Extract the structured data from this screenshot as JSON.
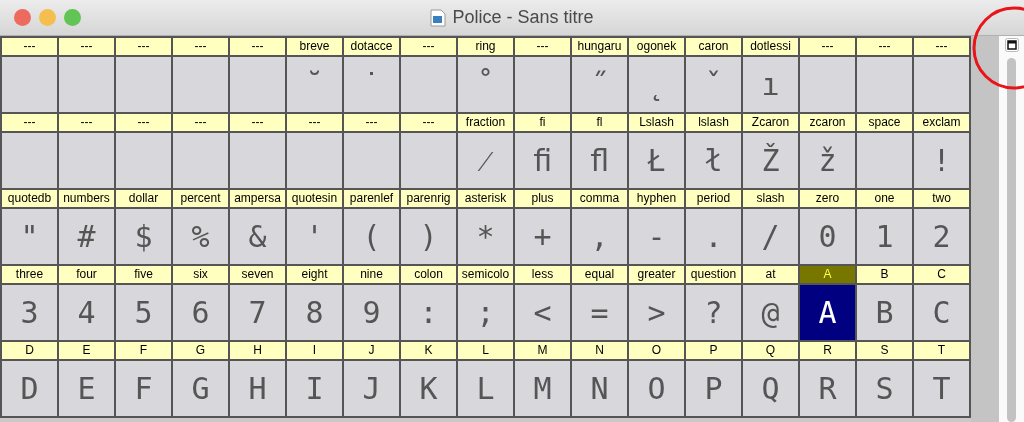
{
  "window": {
    "title": "Police - Sans titre"
  },
  "rows": [
    {
      "cells": [
        {
          "name": "---",
          "selected": false
        },
        {
          "name": "---",
          "selected": false
        },
        {
          "name": "---",
          "selected": false
        },
        {
          "name": "---",
          "selected": false
        },
        {
          "name": "---",
          "selected": false
        },
        {
          "name": "breve",
          "glyph": "˘",
          "selected": false
        },
        {
          "name": "dotacce",
          "glyph": "˙",
          "selected": false
        },
        {
          "name": "---",
          "selected": false
        },
        {
          "name": "ring",
          "glyph": "˚",
          "selected": false
        },
        {
          "name": "---",
          "selected": false
        },
        {
          "name": "hungaru",
          "glyph": "˝",
          "selected": false
        },
        {
          "name": "ogonek",
          "glyph": "˛",
          "selected": false
        },
        {
          "name": "caron",
          "glyph": "ˇ",
          "selected": false
        },
        {
          "name": "dotlessi",
          "glyph": "ı",
          "selected": false
        },
        {
          "name": "---",
          "selected": false
        },
        {
          "name": "---",
          "selected": false
        },
        {
          "name": "---",
          "selected": false
        }
      ]
    },
    {
      "cells": [
        {
          "name": "---",
          "selected": false
        },
        {
          "name": "---",
          "selected": false
        },
        {
          "name": "---",
          "selected": false
        },
        {
          "name": "---",
          "selected": false
        },
        {
          "name": "---",
          "selected": false
        },
        {
          "name": "---",
          "selected": false
        },
        {
          "name": "---",
          "selected": false
        },
        {
          "name": "---",
          "selected": false
        },
        {
          "name": "fraction",
          "glyph": "⁄",
          "selected": false
        },
        {
          "name": "fi",
          "glyph": "ﬁ",
          "selected": false
        },
        {
          "name": "fl",
          "glyph": "ﬂ",
          "selected": false
        },
        {
          "name": "Lslash",
          "glyph": "Ł",
          "selected": false
        },
        {
          "name": "lslash",
          "glyph": "ł",
          "selected": false
        },
        {
          "name": "Zcaron",
          "glyph": "Ž",
          "selected": false
        },
        {
          "name": "zcaron",
          "glyph": "ž",
          "selected": false
        },
        {
          "name": "space",
          "selected": false
        },
        {
          "name": "exclam",
          "glyph": "!",
          "selected": false
        }
      ]
    },
    {
      "cells": [
        {
          "name": "quotedb",
          "glyph": "\"",
          "selected": false
        },
        {
          "name": "numbers",
          "glyph": "#",
          "selected": false
        },
        {
          "name": "dollar",
          "glyph": "$",
          "selected": false
        },
        {
          "name": "percent",
          "glyph": "%",
          "selected": false
        },
        {
          "name": "ampersa",
          "glyph": "&",
          "selected": false
        },
        {
          "name": "quotesin",
          "glyph": "'",
          "selected": false
        },
        {
          "name": "parenlef",
          "glyph": "(",
          "selected": false
        },
        {
          "name": "parenrig",
          "glyph": ")",
          "selected": false
        },
        {
          "name": "asterisk",
          "glyph": "*",
          "selected": false
        },
        {
          "name": "plus",
          "glyph": "+",
          "selected": false
        },
        {
          "name": "comma",
          "glyph": ",",
          "selected": false
        },
        {
          "name": "hyphen",
          "glyph": "-",
          "selected": false
        },
        {
          "name": "period",
          "glyph": ".",
          "selected": false
        },
        {
          "name": "slash",
          "glyph": "/",
          "selected": false
        },
        {
          "name": "zero",
          "glyph": "0",
          "selected": false
        },
        {
          "name": "one",
          "glyph": "1",
          "selected": false
        },
        {
          "name": "two",
          "glyph": "2",
          "selected": false
        }
      ]
    },
    {
      "cells": [
        {
          "name": "three",
          "glyph": "3",
          "selected": false
        },
        {
          "name": "four",
          "glyph": "4",
          "selected": false
        },
        {
          "name": "five",
          "glyph": "5",
          "selected": false
        },
        {
          "name": "six",
          "glyph": "6",
          "selected": false
        },
        {
          "name": "seven",
          "glyph": "7",
          "selected": false
        },
        {
          "name": "eight",
          "glyph": "8",
          "selected": false
        },
        {
          "name": "nine",
          "glyph": "9",
          "selected": false
        },
        {
          "name": "colon",
          "glyph": ":",
          "selected": false
        },
        {
          "name": "semicolo",
          "glyph": ";",
          "selected": false
        },
        {
          "name": "less",
          "glyph": "<",
          "selected": false
        },
        {
          "name": "equal",
          "glyph": "=",
          "selected": false
        },
        {
          "name": "greater",
          "glyph": ">",
          "selected": false
        },
        {
          "name": "question",
          "glyph": "?",
          "selected": false
        },
        {
          "name": "at",
          "glyph": "@",
          "selected": false
        },
        {
          "name": "A",
          "glyph": "A",
          "selected": true
        },
        {
          "name": "B",
          "glyph": "B",
          "selected": false
        },
        {
          "name": "C",
          "glyph": "C",
          "selected": false
        }
      ]
    },
    {
      "cells": [
        {
          "name": "D",
          "glyph": "D",
          "selected": false
        },
        {
          "name": "E",
          "glyph": "E",
          "selected": false
        },
        {
          "name": "F",
          "glyph": "F",
          "selected": false
        },
        {
          "name": "G",
          "glyph": "G",
          "selected": false
        },
        {
          "name": "H",
          "glyph": "H",
          "selected": false
        },
        {
          "name": "I",
          "glyph": "I",
          "selected": false
        },
        {
          "name": "J",
          "glyph": "J",
          "selected": false
        },
        {
          "name": "K",
          "glyph": "K",
          "selected": false
        },
        {
          "name": "L",
          "glyph": "L",
          "selected": false
        },
        {
          "name": "M",
          "glyph": "M",
          "selected": false
        },
        {
          "name": "N",
          "glyph": "N",
          "selected": false
        },
        {
          "name": "O",
          "glyph": "O",
          "selected": false
        },
        {
          "name": "P",
          "glyph": "P",
          "selected": false
        },
        {
          "name": "Q",
          "glyph": "Q",
          "selected": false
        },
        {
          "name": "R",
          "glyph": "R",
          "selected": false
        },
        {
          "name": "S",
          "glyph": "S",
          "selected": false
        },
        {
          "name": "T",
          "glyph": "T",
          "selected": false
        }
      ]
    }
  ]
}
